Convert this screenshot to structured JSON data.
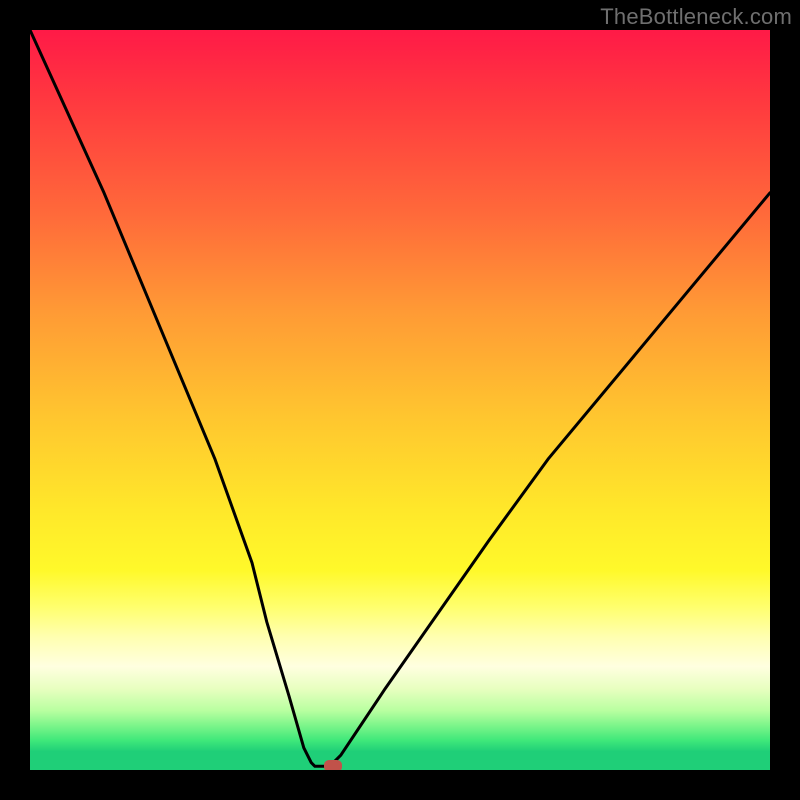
{
  "watermark": "TheBottleneck.com",
  "chart_data": {
    "type": "line",
    "title": "",
    "xlabel": "",
    "ylabel": "",
    "xlim": [
      0,
      100
    ],
    "ylim": [
      0,
      100
    ],
    "series": [
      {
        "name": "bottleneck-curve",
        "x": [
          0,
          5,
          10,
          15,
          20,
          25,
          30,
          32,
          35,
          37,
          38,
          38.5,
          40,
          41,
          42,
          44,
          48,
          55,
          62,
          70,
          80,
          90,
          100
        ],
        "values": [
          100,
          89,
          78,
          66,
          54,
          42,
          28,
          20,
          10,
          3,
          1,
          0.5,
          0.5,
          1,
          2,
          5,
          11,
          21,
          31,
          42,
          54,
          66,
          78
        ]
      }
    ],
    "marker": {
      "x": 41,
      "y": 0.5,
      "color": "#c1524a"
    },
    "background_gradient": [
      {
        "stop": 0,
        "color": "#ff1a47"
      },
      {
        "stop": 0.1,
        "color": "#ff3a3f"
      },
      {
        "stop": 0.25,
        "color": "#ff6a3a"
      },
      {
        "stop": 0.38,
        "color": "#ff9a35"
      },
      {
        "stop": 0.52,
        "color": "#ffc52f"
      },
      {
        "stop": 0.65,
        "color": "#ffe82a"
      },
      {
        "stop": 0.73,
        "color": "#fff92a"
      },
      {
        "stop": 0.78,
        "color": "#ffff6e"
      },
      {
        "stop": 0.82,
        "color": "#ffffb0"
      },
      {
        "stop": 0.86,
        "color": "#ffffe0"
      },
      {
        "stop": 0.89,
        "color": "#e8ffc0"
      },
      {
        "stop": 0.92,
        "color": "#b8ffa0"
      },
      {
        "stop": 0.94,
        "color": "#7cf58a"
      },
      {
        "stop": 0.96,
        "color": "#3fe87a"
      },
      {
        "stop": 0.975,
        "color": "#1fcf78"
      },
      {
        "stop": 1.0,
        "color": "#1fcf78"
      }
    ]
  }
}
